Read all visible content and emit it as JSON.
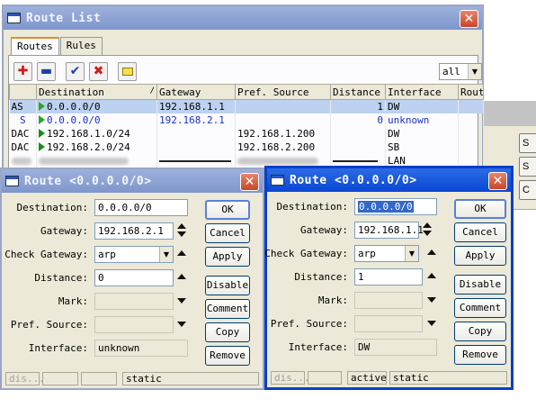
{
  "route_list": {
    "title": "Route List",
    "tabs": [
      "Routes",
      "Rules"
    ],
    "toolbar": {
      "filter_value": "all",
      "icons": [
        "add-icon",
        "remove-icon",
        "enable-check-icon",
        "disable-x-icon",
        "comment-note-icon"
      ]
    },
    "columns": [
      "",
      "Destination",
      "Gateway",
      "Pref. Source",
      "Distance",
      "Interface",
      "Routi"
    ],
    "rows": [
      {
        "flags": "AS",
        "destination": "0.0.0.0/0",
        "gateway": "192.168.1.1",
        "pref_source": "",
        "distance": "1",
        "interface": "DW"
      },
      {
        "flags": "S",
        "destination": "0.0.0.0/0",
        "gateway": "192.168.2.1",
        "pref_source": "",
        "distance": "0",
        "interface": "unknown"
      },
      {
        "flags": "DAC",
        "destination": "192.168.1.0/24",
        "gateway": "",
        "pref_source": "192.168.1.200",
        "distance": "",
        "interface": "DW"
      },
      {
        "flags": "DAC",
        "destination": "192.168.2.0/24",
        "gateway": "",
        "pref_source": "192.168.2.200",
        "distance": "",
        "interface": "SB"
      },
      {
        "flags": "",
        "destination": "",
        "gateway": "",
        "pref_source": "",
        "distance": "",
        "interface": "LAN"
      }
    ]
  },
  "labels": {
    "destination": "Destination:",
    "gateway": "Gateway:",
    "check_gateway": "Check Gateway:",
    "distance": "Distance:",
    "mark": "Mark:",
    "pref_source": "Pref. Source:",
    "interface": "Interface:"
  },
  "buttons": [
    "OK",
    "Cancel",
    "Apply",
    "Disable",
    "Comment",
    "Copy",
    "Remove"
  ],
  "dialog_left": {
    "title": "Route <0.0.0.0/0>",
    "destination": "0.0.0.0/0",
    "gateway": "192.168.2.1",
    "check_gateway": "arp",
    "distance": "0",
    "interface": "unknown",
    "status": [
      "dis...",
      "",
      "",
      "",
      "static"
    ]
  },
  "dialog_right": {
    "title": "Route <0.0.0.0/0>",
    "destination": "0.0.0.0/0",
    "gateway": "192.168.1.1",
    "check_gateway": "arp",
    "distance": "1",
    "interface": "DW",
    "status": [
      "dis...",
      "",
      "",
      "active",
      "static"
    ]
  },
  "background_window": {
    "buttons": [
      "S",
      "S",
      "C"
    ]
  }
}
